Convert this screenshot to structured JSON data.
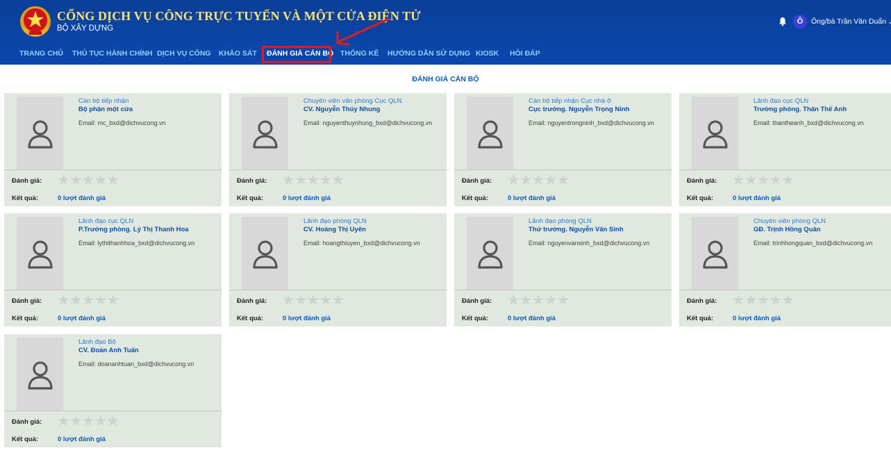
{
  "header": {
    "title": "CỔNG DỊCH VỤ CÔNG TRỰC TUYẾN VÀ MỘT CỬA ĐIỆN TỬ",
    "subtitle": "BỘ XÂY DỰNG",
    "user_initial": "Ô",
    "user_name": "Ông/bà Trần Văn Duẩn",
    "accent": "#ffe56b",
    "bg": "#0b48ad"
  },
  "nav": [
    {
      "label": "TRANG CHỦ"
    },
    {
      "label": "THỦ TỤC HÀNH CHÍNH"
    },
    {
      "label": "DỊCH VỤ CÔNG"
    },
    {
      "label": "KHẢO SÁT"
    },
    {
      "label": "ĐÁNH GIÁ CÁN BỘ",
      "active": true
    },
    {
      "label": "THỐNG KÊ"
    },
    {
      "label": "HƯỚNG DẪN SỬ DỤNG"
    },
    {
      "label": "KIOSK"
    },
    {
      "label": "HỎI ĐÁP"
    }
  ],
  "page_title": "ĐÁNH GIÁ CÁN BỘ",
  "labels": {
    "rating": "Đánh giá:",
    "result": "Kết quả:",
    "stars": "★★★★★"
  },
  "officers": [
    {
      "role": "Cán bộ tiếp nhận",
      "name": "Bộ phận một cửa",
      "email": "Email: mc_bxd@dichvucong.vn",
      "result": "0 lượt đánh giá",
      "rating": 0
    },
    {
      "role": "Chuyên viên văn phòng Cục QLN",
      "name": "CV. Nguyễn Thúy Nhung",
      "email": "Email: nguyenthuynhung_bxd@dichvucong.vn",
      "result": "0 lượt đánh giá",
      "rating": 0
    },
    {
      "role": "Cán bộ tiếp nhận Cục nhà ở",
      "name": "Cục trưởng. Nguyễn Trọng Ninh",
      "email": "Email: nguyentrongninh_bxd@dichvucong.vn",
      "result": "0 lượt đánh giá",
      "rating": 0
    },
    {
      "role": "Lãnh đạo cục QLN",
      "name": "Trưởng phòng. Thân Thế Anh",
      "email": "Email: thantheanh_bxd@dichvucong.vn",
      "result": "0 lượt đánh giá",
      "rating": 0
    },
    {
      "role": "Lãnh đạo cục QLN",
      "name": "P.Trưởng phòng. Lý Thị Thanh Hoa",
      "email": "Email: lythithanhhoa_bxd@dichvucong.vn",
      "result": "0 lượt đánh giá",
      "rating": 0
    },
    {
      "role": "Lãnh đạo phòng QLN",
      "name": "CV. Hoàng Thị Uyên",
      "email": "Email: hoangthiuyen_bxd@dichvucong.vn",
      "result": "0 lượt đánh giá",
      "rating": 0
    },
    {
      "role": "Lãnh đạo phòng QLN",
      "name": "Thứ trưởng. Nguyễn Văn Sinh",
      "email": "Email: nguyenvansinh_bxd@dichvucong.vn",
      "result": "0 lượt đánh giá",
      "rating": 0
    },
    {
      "role": "Chuyên viên phòng QLN",
      "name": "GĐ. Trịnh Hồng Quân",
      "email": "Email: trinhhongquan_bxd@dichvucong.vn",
      "result": "0 lượt đánh giá",
      "rating": 0
    },
    {
      "role": "Lãnh đạo Bộ",
      "name": "CV. Đoàn Anh Tuấn",
      "email": "Email: doananhtuan_bxd@dichvucong.vn",
      "result": "0 lượt đánh giá",
      "rating": 0
    }
  ]
}
